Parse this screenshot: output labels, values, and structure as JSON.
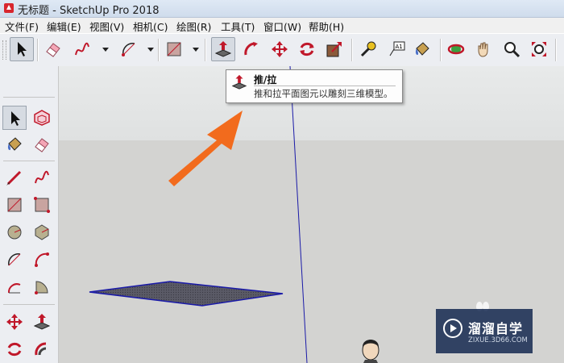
{
  "window": {
    "title": "无标题 - SketchUp Pro 2018",
    "app_icon": "sketchup-logo-icon"
  },
  "menu": [
    "文件(F)",
    "编辑(E)",
    "视图(V)",
    "相机(C)",
    "绘图(R)",
    "工具(T)",
    "窗口(W)",
    "帮助(H)"
  ],
  "toolbar": {
    "tools": [
      "select-icon",
      "eraser-icon",
      "freehand-icon",
      "arc-icon",
      "rectangle-icon",
      "push-pull-icon",
      "follow-me-icon",
      "move-icon",
      "rotate-icon",
      "scale-icon",
      "tape-measure-icon",
      "text-icon",
      "paint-bucket-icon",
      "orbit-icon",
      "pan-icon",
      "zoom-icon",
      "zoom-extents-icon"
    ],
    "text_tool_glyph": "A1",
    "active_tool": "push-pull"
  },
  "tooltip": {
    "title": "推/拉",
    "description": "推和拉平面图元以雕刻三维模型。"
  },
  "annotation": {
    "arrow_color": "#f26b1d"
  },
  "viewport": {
    "ground_color": "#d3d3d1",
    "sky_color": "#e4e6e6",
    "axis_color": "#1a1aa8",
    "face_color": "#5a5a66"
  },
  "watermark": {
    "name": "溜溜自学",
    "url": "ZIXUE.3D66.COM"
  }
}
